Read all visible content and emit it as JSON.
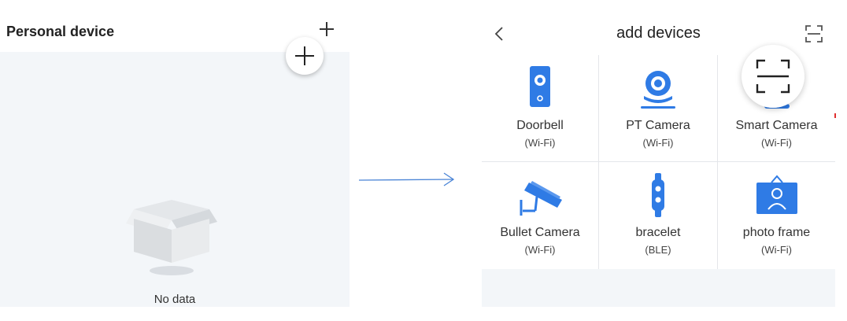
{
  "left": {
    "title": "Personal device",
    "empty_text": "No data"
  },
  "right": {
    "title": "add devices",
    "devices": [
      {
        "name": "Doorbell",
        "protocol": "(Wi-Fi)",
        "icon": "doorbell-icon"
      },
      {
        "name": "PT Camera",
        "protocol": "(Wi-Fi)",
        "icon": "pt-camera-icon"
      },
      {
        "name": "Smart Camera",
        "protocol": "(Wi-Fi)",
        "icon": "smart-camera-icon"
      },
      {
        "name": "Bullet Camera",
        "protocol": "(Wi-Fi)",
        "icon": "bullet-camera-icon"
      },
      {
        "name": "bracelet",
        "protocol": "(BLE)",
        "icon": "bracelet-icon"
      },
      {
        "name": "photo frame",
        "protocol": "(Wi-Fi)",
        "icon": "photo-frame-icon"
      }
    ]
  },
  "colors": {
    "accent": "#2f7be5",
    "panel_bg": "#f3f6f9",
    "divider": "#e4e6ea"
  }
}
